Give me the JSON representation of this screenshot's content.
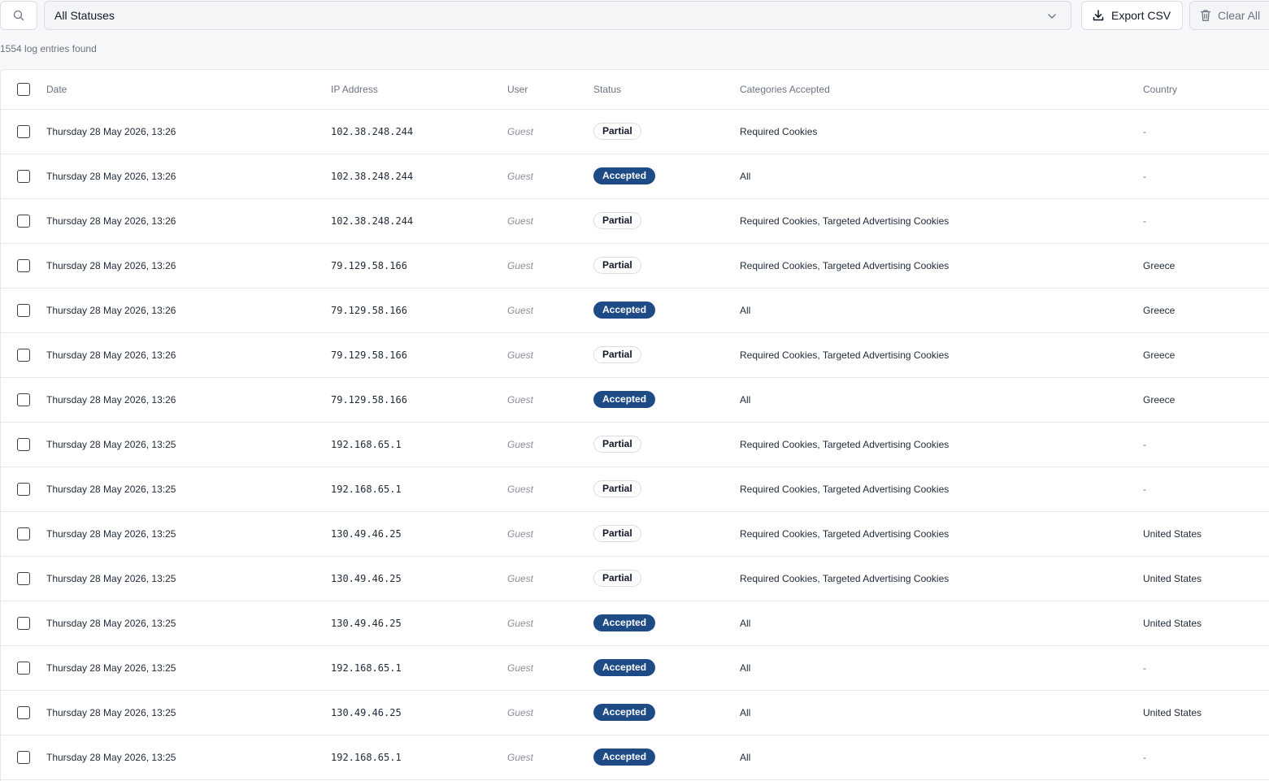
{
  "toolbar": {
    "search_icon": "search-icon",
    "status_filter": "All Statuses",
    "export_label": "Export CSV",
    "clear_label": "Clear All"
  },
  "summary": "1554 log entries found",
  "columns": [
    "Date",
    "IP Address",
    "User",
    "Status",
    "Categories Accepted",
    "Country"
  ],
  "colors": {
    "accepted": "#1e4b85",
    "partial_border": "#d9dde3"
  },
  "rows": [
    {
      "date": "Thursday 28 May 2026, 13:26",
      "ip": "102.38.248.244",
      "user": "Guest",
      "status": "Partial",
      "categories": "Required Cookies",
      "country": "-"
    },
    {
      "date": "Thursday 28 May 2026, 13:26",
      "ip": "102.38.248.244",
      "user": "Guest",
      "status": "Accepted",
      "categories": "All",
      "country": "-"
    },
    {
      "date": "Thursday 28 May 2026, 13:26",
      "ip": "102.38.248.244",
      "user": "Guest",
      "status": "Partial",
      "categories": "Required Cookies, Targeted Advertising Cookies",
      "country": "-"
    },
    {
      "date": "Thursday 28 May 2026, 13:26",
      "ip": "79.129.58.166",
      "user": "Guest",
      "status": "Partial",
      "categories": "Required Cookies, Targeted Advertising Cookies",
      "country": "Greece"
    },
    {
      "date": "Thursday 28 May 2026, 13:26",
      "ip": "79.129.58.166",
      "user": "Guest",
      "status": "Accepted",
      "categories": "All",
      "country": "Greece"
    },
    {
      "date": "Thursday 28 May 2026, 13:26",
      "ip": "79.129.58.166",
      "user": "Guest",
      "status": "Partial",
      "categories": "Required Cookies, Targeted Advertising Cookies",
      "country": "Greece"
    },
    {
      "date": "Thursday 28 May 2026, 13:26",
      "ip": "79.129.58.166",
      "user": "Guest",
      "status": "Accepted",
      "categories": "All",
      "country": "Greece"
    },
    {
      "date": "Thursday 28 May 2026, 13:25",
      "ip": "192.168.65.1",
      "user": "Guest",
      "status": "Partial",
      "categories": "Required Cookies, Targeted Advertising Cookies",
      "country": "-"
    },
    {
      "date": "Thursday 28 May 2026, 13:25",
      "ip": "192.168.65.1",
      "user": "Guest",
      "status": "Partial",
      "categories": "Required Cookies, Targeted Advertising Cookies",
      "country": "-"
    },
    {
      "date": "Thursday 28 May 2026, 13:25",
      "ip": "130.49.46.25",
      "user": "Guest",
      "status": "Partial",
      "categories": "Required Cookies, Targeted Advertising Cookies",
      "country": "United States"
    },
    {
      "date": "Thursday 28 May 2026, 13:25",
      "ip": "130.49.46.25",
      "user": "Guest",
      "status": "Partial",
      "categories": "Required Cookies, Targeted Advertising Cookies",
      "country": "United States"
    },
    {
      "date": "Thursday 28 May 2026, 13:25",
      "ip": "130.49.46.25",
      "user": "Guest",
      "status": "Accepted",
      "categories": "All",
      "country": "United States"
    },
    {
      "date": "Thursday 28 May 2026, 13:25",
      "ip": "192.168.65.1",
      "user": "Guest",
      "status": "Accepted",
      "categories": "All",
      "country": "-"
    },
    {
      "date": "Thursday 28 May 2026, 13:25",
      "ip": "130.49.46.25",
      "user": "Guest",
      "status": "Accepted",
      "categories": "All",
      "country": "United States"
    },
    {
      "date": "Thursday 28 May 2026, 13:25",
      "ip": "192.168.65.1",
      "user": "Guest",
      "status": "Accepted",
      "categories": "All",
      "country": "-"
    }
  ]
}
